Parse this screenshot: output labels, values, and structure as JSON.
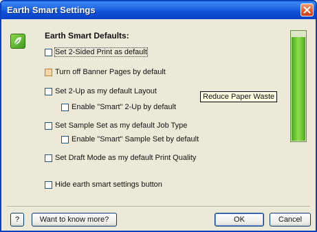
{
  "window": {
    "title": "Earth Smart Settings"
  },
  "heading": "Earth Smart Defaults:",
  "options": [
    {
      "label": "Set 2-Sided Print as default",
      "checked": false,
      "focused": true
    },
    {
      "label": "Turn off Banner Pages by default",
      "checked": false,
      "highlighted": true
    },
    {
      "label": "Set 2-Up as my default Layout",
      "checked": false
    },
    {
      "label": "Enable \"Smart\" 2-Up by default",
      "checked": false
    },
    {
      "label": "Set Sample Set as my default Job Type",
      "checked": false
    },
    {
      "label": "Enable \"Smart\" Sample Set by default",
      "checked": false
    },
    {
      "label": "Set Draft Mode as my default Print Quality",
      "checked": false
    },
    {
      "label": "Hide earth smart settings button",
      "checked": false
    }
  ],
  "tooltip": "Reduce Paper Waste",
  "meter": {
    "level": 0.95
  },
  "buttons": {
    "help": "?",
    "more": "Want to know more?",
    "ok": "OK",
    "cancel": "Cancel"
  },
  "colors": {
    "titlebar": "#0d4fd6",
    "meter": "#4da81f",
    "close": "#e15a2a"
  }
}
